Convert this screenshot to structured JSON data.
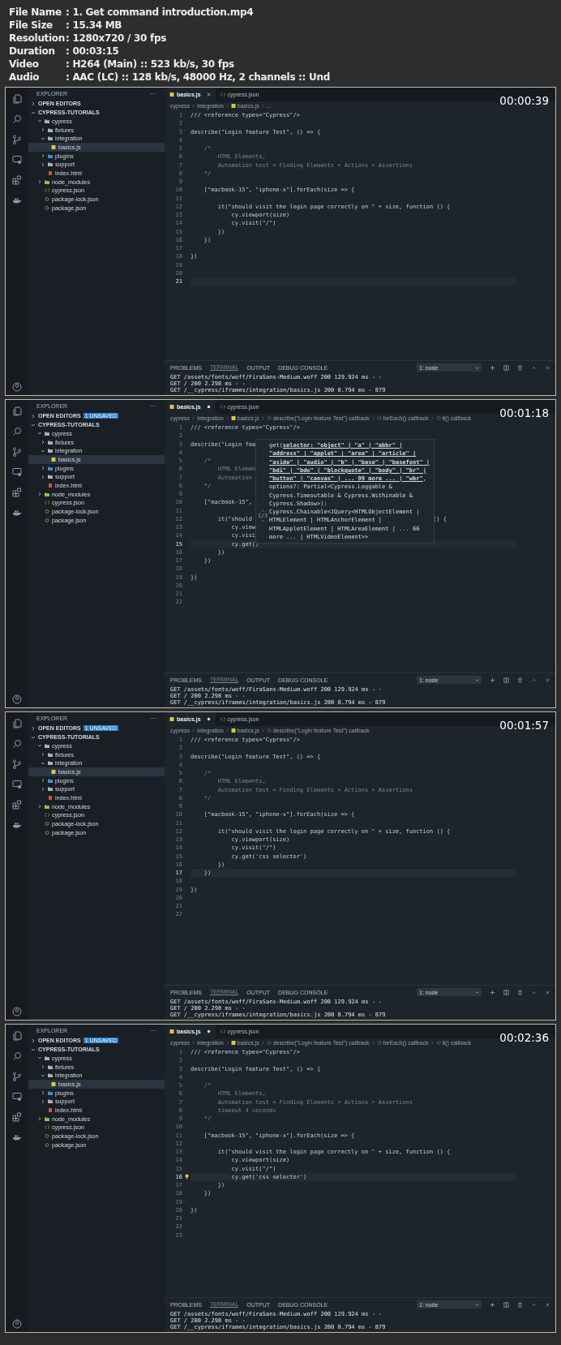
{
  "info": [
    {
      "label": "File Name",
      "value": ": 1. Get command introduction.mp4"
    },
    {
      "label": "File Size",
      "value": ": 15.34 MB"
    },
    {
      "label": "Resolution",
      "value": ": 1280x720 / 30 fps"
    },
    {
      "label": "Duration",
      "value": ": 00:03:15"
    },
    {
      "label": "Video",
      "value": ": H264 (Main) :: 523 kb/s, 30 fps"
    },
    {
      "label": "Audio",
      "value": ": AAC (LC) :: 128 kb/s, 48000 Hz, 2 channels :: Und"
    }
  ],
  "frames": [
    {
      "timestamp": "00:00:39",
      "explorer_title": "EXPLORER",
      "sections": [
        {
          "label": "OPEN EDITORS",
          "expanded": false
        },
        {
          "label": "CYPRESS-TUTORIALS",
          "expanded": true,
          "items": [
            {
              "name": "cypress",
              "kind": "folder",
              "color": "#a8b3c1",
              "expanded": true,
              "selected": false,
              "children": [
                {
                  "name": "fixtures",
                  "kind": "folder",
                  "color": "#a8b3c1",
                  "expanded": false,
                  "selected": false
                },
                {
                  "name": "integration",
                  "kind": "folder",
                  "color": "#a8b3c1",
                  "expanded": true,
                  "selected": false,
                  "children": [
                    {
                      "name": "basics.js",
                      "kind": "js",
                      "selected": true
                    }
                  ]
                },
                {
                  "name": "plugins",
                  "kind": "folder",
                  "color": "#3b8fd9",
                  "expanded": false,
                  "selected": false
                },
                {
                  "name": "support",
                  "kind": "folder",
                  "color": "#a8b3c1",
                  "expanded": false,
                  "selected": false
                },
                {
                  "name": "index.html",
                  "kind": "html",
                  "selected": false
                }
              ]
            },
            {
              "name": "node_modules",
              "kind": "folder",
              "color": "#8bc34a",
              "expanded": false,
              "selected": false
            },
            {
              "name": "cypress.json",
              "kind": "json",
              "selected": false
            },
            {
              "name": "package-lock.json",
              "kind": "npm",
              "selected": false
            },
            {
              "name": "package.json",
              "kind": "npm",
              "selected": false
            }
          ]
        }
      ],
      "tabs": [
        {
          "label": "basics.js",
          "kind": "js",
          "selected": true,
          "dirty": false
        },
        {
          "label": "cypress.json",
          "kind": "json",
          "selected": false,
          "dirty": false
        }
      ],
      "breadcrumbs": [
        {
          "label": "cypress",
          "kind": "text"
        },
        {
          "label": "integration",
          "kind": "text"
        },
        {
          "label": "basics.js",
          "kind": "js"
        },
        {
          "label": "...",
          "kind": "text"
        }
      ],
      "lines": [
        {
          "number": "1",
          "text": "/// <reference types=\"Cypress\"/>",
          "kind": "code",
          "current": false
        },
        {
          "number": "2",
          "current": false
        },
        {
          "number": "3",
          "text": "describe(\"Login feature Test\", () => {",
          "kind": "code",
          "current": false
        },
        {
          "number": "4",
          "current": false
        },
        {
          "number": "5",
          "text": "    /*",
          "kind": "comment",
          "current": false
        },
        {
          "number": "6",
          "text": "        HTML Elements,",
          "kind": "comment",
          "current": false
        },
        {
          "number": "7",
          "text": "        Automation test = Finding Elements + Actions + Assertions",
          "kind": "comment",
          "current": false
        },
        {
          "number": "8",
          "text": "    */",
          "kind": "comment",
          "current": false
        },
        {
          "number": "9",
          "current": false
        },
        {
          "number": "10",
          "text": "    [\"macbook-15\", \"iphone-x\"].forEach(size => {",
          "kind": "code",
          "current": false
        },
        {
          "number": "11",
          "current": false
        },
        {
          "number": "12",
          "text": "        it(\"should visit the login page correctly on \" + size, function () {",
          "kind": "code",
          "current": false
        },
        {
          "number": "13",
          "text": "            cy.viewport(size)",
          "kind": "code",
          "current": false
        },
        {
          "number": "14",
          "text": "            cy.visit(\"/\")",
          "kind": "code",
          "current": false
        },
        {
          "number": "15",
          "text": "        })",
          "kind": "code",
          "current": false
        },
        {
          "number": "16",
          "text": "    })",
          "kind": "code",
          "current": false
        },
        {
          "number": "17",
          "current": false
        },
        {
          "number": "18",
          "text": "})",
          "kind": "code",
          "current": false
        },
        {
          "number": "19",
          "current": false
        },
        {
          "number": "20",
          "current": false
        },
        {
          "number": "21",
          "current": true
        }
      ],
      "panel_tabs": [
        {
          "label": "PROBLEMS",
          "selected": false
        },
        {
          "label": "TERMINAL",
          "selected": true
        },
        {
          "label": "OUTPUT",
          "selected": false
        },
        {
          "label": "DEBUG CONSOLE",
          "selected": false
        }
      ],
      "terminal_select": "1: node",
      "log": [
        "GET /assets/fonts/woff/FiraSans-Medium.woff 200 129.924 ms - -",
        "GET / 200 2.298 ms - -",
        "GET /__cypress/iframes/integration/basics.js 200 0.794 ms - 879"
      ]
    },
    {
      "timestamp": "00:01:18",
      "explorer_title": "EXPLORER",
      "sections": [
        {
          "label": "OPEN EDITORS",
          "expanded": false,
          "badge": "1 UNSAVED"
        },
        {
          "label": "CYPRESS-TUTORIALS",
          "expanded": true,
          "items": [
            {
              "name": "cypress",
              "kind": "folder",
              "color": "#a8b3c1",
              "expanded": true,
              "selected": false,
              "children": [
                {
                  "name": "fixtures",
                  "kind": "folder",
                  "color": "#a8b3c1",
                  "expanded": false,
                  "selected": false
                },
                {
                  "name": "integration",
                  "kind": "folder",
                  "color": "#a8b3c1",
                  "expanded": true,
                  "selected": false,
                  "children": [
                    {
                      "name": "basics.js",
                      "kind": "js",
                      "selected": true
                    }
                  ]
                },
                {
                  "name": "plugins",
                  "kind": "folder",
                  "color": "#3b8fd9",
                  "expanded": false,
                  "selected": false
                },
                {
                  "name": "support",
                  "kind": "folder",
                  "color": "#a8b3c1",
                  "expanded": false,
                  "selected": false
                },
                {
                  "name": "index.html",
                  "kind": "html",
                  "selected": false
                }
              ]
            },
            {
              "name": "node_modules",
              "kind": "folder",
              "color": "#8bc34a",
              "expanded": false,
              "selected": false
            },
            {
              "name": "cypress.json",
              "kind": "json",
              "selected": false
            },
            {
              "name": "package-lock.json",
              "kind": "npm",
              "selected": false
            },
            {
              "name": "package.json",
              "kind": "npm",
              "selected": false
            }
          ]
        }
      ],
      "tabs": [
        {
          "label": "basics.js",
          "kind": "js",
          "selected": true,
          "dirty": true
        },
        {
          "label": "cypress.json",
          "kind": "json",
          "selected": false,
          "dirty": false
        }
      ],
      "breadcrumbs": [
        {
          "label": "cypress",
          "kind": "text"
        },
        {
          "label": "integration",
          "kind": "text"
        },
        {
          "label": "basics.js",
          "kind": "js"
        },
        {
          "label": "describe(\"Login feature Test\") callback",
          "kind": "symbol"
        },
        {
          "label": "forEach() callback",
          "kind": "symbol"
        },
        {
          "label": "it() callback",
          "kind": "symbol"
        }
      ],
      "lines": [
        {
          "number": "1",
          "text": "/// <reference types=\"Cypress\"/>",
          "kind": "code",
          "current": false
        },
        {
          "number": "2",
          "current": false
        },
        {
          "number": "3",
          "text": "describe(\"Login fea",
          "kind": "code",
          "current": false
        },
        {
          "number": "4",
          "current": false
        },
        {
          "number": "5",
          "text": "    /*",
          "kind": "comment",
          "current": false
        },
        {
          "number": "6",
          "text": "        HTML Elemen",
          "kind": "comment",
          "current": false
        },
        {
          "number": "7",
          "text": "        Automation",
          "kind": "comment",
          "current": false
        },
        {
          "number": "8",
          "text": "    */",
          "kind": "comment",
          "current": false
        },
        {
          "number": "9",
          "current": false
        },
        {
          "number": "10",
          "text": "    [\"macbook-15\",",
          "kind": "code",
          "current": false
        },
        {
          "number": "11",
          "current": false
        },
        {
          "number": "12",
          "text": "        it(\"should",
          "after": "() {",
          "kind": "code",
          "current": false
        },
        {
          "number": "13",
          "text": "            cy.view",
          "kind": "code",
          "current": false
        },
        {
          "number": "14",
          "text": "            cy.visi",
          "kind": "code",
          "current": false
        },
        {
          "number": "15",
          "text": "            cy.get()",
          "kind": "code",
          "current": true
        },
        {
          "number": "16",
          "text": "        })",
          "kind": "code",
          "current": false
        },
        {
          "number": "17",
          "text": "    })",
          "kind": "code",
          "current": false
        },
        {
          "number": "18",
          "current": false
        },
        {
          "number": "19",
          "text": "})",
          "kind": "code",
          "current": false
        },
        {
          "number": "20",
          "current": false
        },
        {
          "number": "21",
          "current": false
        },
        {
          "number": "22",
          "current": false
        }
      ],
      "tooltip": {
        "counter": "1/3",
        "lines": [
          [
            {
              "text": "get(",
              "underline": false
            },
            {
              "text": "selector: \"object\" | \"a\" | \"abbr\" |",
              "underline": true
            }
          ],
          [
            {
              "text": "\"address\" | \"applet\" | \"area\" | \"article\" |",
              "underline": true
            }
          ],
          [
            {
              "text": "\"aside\" | \"audio\" | \"b\" | \"base\" | \"basefont\" |",
              "underline": true
            }
          ],
          [
            {
              "text": "\"bdi\" | \"bdo\" | \"blockquote\" | \"body\" | \"br\" |",
              "underline": true
            }
          ],
          [
            {
              "text": "\"button\" | \"canvas\" | ... 99 more ... | \"wbr\"",
              "underline": true
            },
            {
              "text": ",",
              "underline": false
            }
          ],
          [
            {
              "text": "options?: Partial<Cypress.Loggable &",
              "underline": false
            }
          ],
          [
            {
              "text": "Cypress.Timeoutable & Cypress.Withinable &",
              "underline": false
            }
          ],
          [
            {
              "text": "Cypress.Shadow>):",
              "underline": false
            }
          ],
          [
            {
              "text": "Cypress.Chainable<JQuery<HTMLObjectElement |",
              "underline": false
            }
          ],
          [
            {
              "text": "HTMLElement | HTMLAnchorElement |",
              "underline": false
            }
          ],
          [
            {
              "text": "HTMLAppletElement | HTMLAreaElement | ... 66",
              "underline": false
            }
          ],
          [
            {
              "text": "more ... | HTMLVideoElement>>",
              "underline": false
            }
          ]
        ]
      },
      "panel_tabs": [
        {
          "label": "PROBLEMS",
          "selected": false
        },
        {
          "label": "TERMINAL",
          "selected": true
        },
        {
          "label": "OUTPUT",
          "selected": false
        },
        {
          "label": "DEBUG CONSOLE",
          "selected": false
        }
      ],
      "terminal_select": "1: node",
      "log": [
        "GET /assets/fonts/woff/FiraSans-Medium.woff 200 129.924 ms - -",
        "GET / 200 2.298 ms - -",
        "GET /__cypress/iframes/integration/basics.js 200 0.794 ms - 879"
      ]
    },
    {
      "timestamp": "00:01:57",
      "explorer_title": "EXPLORER",
      "sections": [
        {
          "label": "OPEN EDITORS",
          "expanded": false,
          "badge": "1 UNSAVED"
        },
        {
          "label": "CYPRESS-TUTORIALS",
          "expanded": true,
          "items": [
            {
              "name": "cypress",
              "kind": "folder",
              "color": "#a8b3c1",
              "expanded": true,
              "selected": false,
              "children": [
                {
                  "name": "fixtures",
                  "kind": "folder",
                  "color": "#a8b3c1",
                  "expanded": false,
                  "selected": false
                },
                {
                  "name": "integration",
                  "kind": "folder",
                  "color": "#a8b3c1",
                  "expanded": true,
                  "selected": false,
                  "children": [
                    {
                      "name": "basics.js",
                      "kind": "js",
                      "selected": true
                    }
                  ]
                },
                {
                  "name": "plugins",
                  "kind": "folder",
                  "color": "#3b8fd9",
                  "expanded": false,
                  "selected": false
                },
                {
                  "name": "support",
                  "kind": "folder",
                  "color": "#a8b3c1",
                  "expanded": false,
                  "selected": false
                },
                {
                  "name": "index.html",
                  "kind": "html",
                  "selected": false
                }
              ]
            },
            {
              "name": "node_modules",
              "kind": "folder",
              "color": "#8bc34a",
              "expanded": false,
              "selected": false
            },
            {
              "name": "cypress.json",
              "kind": "json",
              "selected": false
            },
            {
              "name": "package-lock.json",
              "kind": "npm",
              "selected": false
            },
            {
              "name": "package.json",
              "kind": "npm",
              "selected": false
            }
          ]
        }
      ],
      "tabs": [
        {
          "label": "basics.js",
          "kind": "js",
          "selected": true,
          "dirty": true
        },
        {
          "label": "cypress.json",
          "kind": "json",
          "selected": false,
          "dirty": false
        }
      ],
      "breadcrumbs": [
        {
          "label": "cypress",
          "kind": "text"
        },
        {
          "label": "integration",
          "kind": "text"
        },
        {
          "label": "basics.js",
          "kind": "js"
        },
        {
          "label": "describe(\"Login feature Test\") callback",
          "kind": "symbol"
        }
      ],
      "lines": [
        {
          "number": "1",
          "text": "/// <reference types=\"Cypress\"/>",
          "kind": "code",
          "current": false
        },
        {
          "number": "2",
          "current": false
        },
        {
          "number": "3",
          "text": "describe(\"Login feature Test\", () => {",
          "kind": "code",
          "current": false
        },
        {
          "number": "4",
          "current": false
        },
        {
          "number": "5",
          "text": "    /*",
          "kind": "comment",
          "current": false
        },
        {
          "number": "6",
          "text": "        HTML Elements,",
          "kind": "comment",
          "current": false
        },
        {
          "number": "7",
          "text": "        Automation test = Finding Elements + Actions + Assertions",
          "kind": "comment",
          "current": false
        },
        {
          "number": "8",
          "text": "    */",
          "kind": "comment",
          "current": false
        },
        {
          "number": "9",
          "current": false
        },
        {
          "number": "10",
          "text": "    [\"macbook-15\", \"iphone-x\"].forEach(size => {",
          "kind": "code",
          "current": false
        },
        {
          "number": "11",
          "current": false
        },
        {
          "number": "12",
          "text": "        it(\"should visit the login page correctly on \" + size, function () {",
          "kind": "code",
          "current": false
        },
        {
          "number": "13",
          "text": "            cy.viewport(size)",
          "kind": "code",
          "current": false
        },
        {
          "number": "14",
          "text": "            cy.visit(\"/\")",
          "kind": "code",
          "current": false
        },
        {
          "number": "15",
          "text": "            cy.get('css selector')",
          "kind": "code",
          "current": false
        },
        {
          "number": "16",
          "text": "        })",
          "kind": "code",
          "current": false
        },
        {
          "number": "17",
          "text": "    })",
          "kind": "code",
          "current": true
        },
        {
          "number": "18",
          "current": false
        },
        {
          "number": "19",
          "text": "})",
          "kind": "code",
          "current": false
        },
        {
          "number": "20",
          "current": false
        },
        {
          "number": "21",
          "current": false
        },
        {
          "number": "22",
          "current": false
        }
      ],
      "panel_tabs": [
        {
          "label": "PROBLEMS",
          "selected": false
        },
        {
          "label": "TERMINAL",
          "selected": true
        },
        {
          "label": "OUTPUT",
          "selected": false
        },
        {
          "label": "DEBUG CONSOLE",
          "selected": false
        }
      ],
      "terminal_select": "1: node",
      "log": [
        "GET /assets/fonts/woff/FiraSans-Medium.woff 200 129.924 ms - -",
        "GET / 200 2.298 ms - -",
        "GET /__cypress/iframes/integration/basics.js 200 0.794 ms - 879"
      ]
    },
    {
      "timestamp": "00:02:36",
      "explorer_title": "EXPLORER",
      "sections": [
        {
          "label": "OPEN EDITORS",
          "expanded": false,
          "badge": "1 UNSAVED"
        },
        {
          "label": "CYPRESS-TUTORIALS",
          "expanded": true,
          "items": [
            {
              "name": "cypress",
              "kind": "folder",
              "color": "#a8b3c1",
              "expanded": true,
              "selected": false,
              "children": [
                {
                  "name": "fixtures",
                  "kind": "folder",
                  "color": "#a8b3c1",
                  "expanded": false,
                  "selected": false
                },
                {
                  "name": "integration",
                  "kind": "folder",
                  "color": "#a8b3c1",
                  "expanded": true,
                  "selected": false,
                  "children": [
                    {
                      "name": "basics.js",
                      "kind": "js",
                      "selected": true
                    }
                  ]
                },
                {
                  "name": "plugins",
                  "kind": "folder",
                  "color": "#3b8fd9",
                  "expanded": false,
                  "selected": false
                },
                {
                  "name": "support",
                  "kind": "folder",
                  "color": "#a8b3c1",
                  "expanded": false,
                  "selected": false
                },
                {
                  "name": "index.html",
                  "kind": "html",
                  "selected": false
                }
              ]
            },
            {
              "name": "node_modules",
              "kind": "folder",
              "color": "#8bc34a",
              "expanded": false,
              "selected": false
            },
            {
              "name": "cypress.json",
              "kind": "json",
              "selected": false
            },
            {
              "name": "package-lock.json",
              "kind": "npm",
              "selected": false
            },
            {
              "name": "package.json",
              "kind": "npm",
              "selected": false
            }
          ]
        }
      ],
      "tabs": [
        {
          "label": "basics.js",
          "kind": "js",
          "selected": true,
          "dirty": true
        },
        {
          "label": "cypress.json",
          "kind": "json",
          "selected": false,
          "dirty": false
        }
      ],
      "breadcrumbs": [
        {
          "label": "cypress",
          "kind": "text"
        },
        {
          "label": "integration",
          "kind": "text"
        },
        {
          "label": "basics.js",
          "kind": "js"
        },
        {
          "label": "describe(\"Login feature Test\") callback",
          "kind": "symbol"
        },
        {
          "label": "forEach() callback",
          "kind": "symbol"
        },
        {
          "label": "it() callback",
          "kind": "symbol"
        }
      ],
      "lines": [
        {
          "number": "1",
          "text": "/// <reference types=\"Cypress\"/>",
          "kind": "code",
          "current": false
        },
        {
          "number": "2",
          "current": false
        },
        {
          "number": "3",
          "text": "describe(\"Login feature Test\", () => {",
          "kind": "code",
          "current": false
        },
        {
          "number": "4",
          "current": false
        },
        {
          "number": "5",
          "text": "    /*",
          "kind": "comment",
          "current": false
        },
        {
          "number": "6",
          "text": "        HTML Elements,",
          "kind": "comment",
          "current": false
        },
        {
          "number": "7",
          "text": "        Automation test = Finding Elements + Actions + Assertions",
          "kind": "comment",
          "current": false
        },
        {
          "number": "8",
          "text": "        timeout 4 seconds",
          "kind": "comment",
          "current": false
        },
        {
          "number": "9",
          "text": "    */",
          "kind": "comment",
          "current": false
        },
        {
          "number": "10",
          "current": false
        },
        {
          "number": "11",
          "text": "    [\"macbook-15\", \"iphone-x\"].forEach(size => {",
          "kind": "code",
          "current": false
        },
        {
          "number": "12",
          "current": false
        },
        {
          "number": "13",
          "text": "        it(\"should visit the login page correctly on \" + size, function () {",
          "kind": "code",
          "current": false
        },
        {
          "number": "14",
          "text": "            cy.viewport(size)",
          "kind": "code",
          "current": false
        },
        {
          "number": "15",
          "text": "            cy.visit(\"/\")",
          "kind": "code",
          "current": false
        },
        {
          "number": "16",
          "text": "            cy.get('css selector')",
          "kind": "code",
          "current": true,
          "lightbulb": true
        },
        {
          "number": "17",
          "text": "        })",
          "kind": "code",
          "current": false
        },
        {
          "number": "18",
          "text": "    })",
          "kind": "code",
          "current": false
        },
        {
          "number": "19",
          "current": false
        },
        {
          "number": "20",
          "text": "})",
          "kind": "code",
          "current": false
        },
        {
          "number": "21",
          "current": false
        },
        {
          "number": "22",
          "current": false
        },
        {
          "number": "23",
          "current": false
        }
      ],
      "panel_tabs": [
        {
          "label": "PROBLEMS",
          "selected": false
        },
        {
          "label": "TERMINAL",
          "selected": true
        },
        {
          "label": "OUTPUT",
          "selected": false
        },
        {
          "label": "DEBUG CONSOLE",
          "selected": false
        }
      ],
      "terminal_select": "1: node",
      "log": [
        "GET /assets/fonts/woff/FiraSans-Medium.woff 200 129.924 ms - -",
        "GET / 200 2.298 ms - -",
        "GET /__cypress/iframes/integration/basics.js 200 0.794 ms - 879"
      ]
    }
  ]
}
